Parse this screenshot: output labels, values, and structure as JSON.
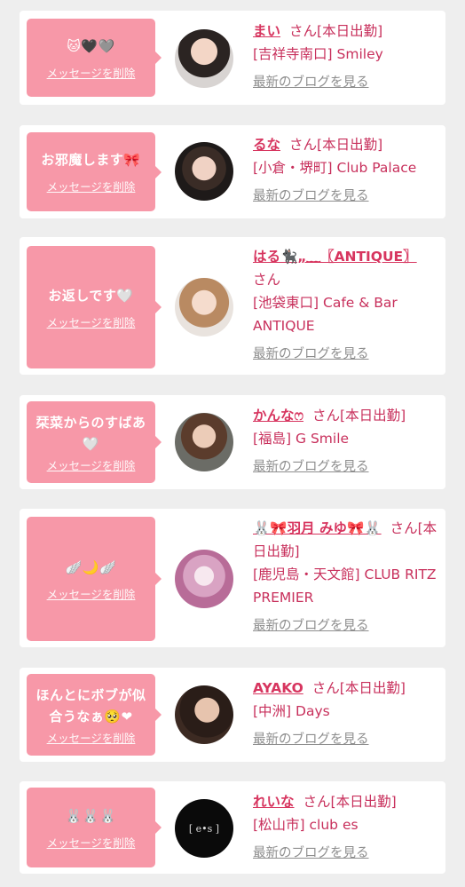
{
  "delete_label": "メッセージを削除",
  "blog_label": "最新のブログを見る",
  "san": "さん",
  "entries": [
    {
      "message": "🐱🖤🩶",
      "name": "まい",
      "status": "[本日出勤]",
      "location": "[吉祥寺南口] Smiley"
    },
    {
      "message": "お邪魔します🎀",
      "name": "るな",
      "status": "[本日出勤]",
      "location": "[小倉・堺町] Club Palace"
    },
    {
      "message": "お返しです🤍",
      "name": "はる🐈‍⬛„﹏〖ANTIQUE〗",
      "status": "",
      "location": "[池袋東口] Cafe & Bar ANTIQUE"
    },
    {
      "message": "栞菜からのすばあ🤍",
      "name": "かんなෆ",
      "status": "[本日出勤]",
      "location": "[福島] G Smile"
    },
    {
      "message": "🪽🌙🪽",
      "name": "🐰🎀羽月 みゆ🎀🐰",
      "status": "[本日出勤]",
      "location": "[鹿児島・天文館] CLUB RITZ PREMIER"
    },
    {
      "message": "ほんとにボブが似合うなぁ🥺❤",
      "name": "AYAKO",
      "status": "[本日出勤]",
      "location": "[中洲] Days"
    },
    {
      "message": "🐰🐰🐰",
      "name": "れいな",
      "status": "[本日出勤]",
      "location": "[松山市] club es"
    }
  ],
  "colors": {
    "bubble": "#f798a8",
    "name": "#d7355f",
    "text": "#c8305c",
    "link": "#8e8e8e",
    "background": "#eeeeee"
  }
}
